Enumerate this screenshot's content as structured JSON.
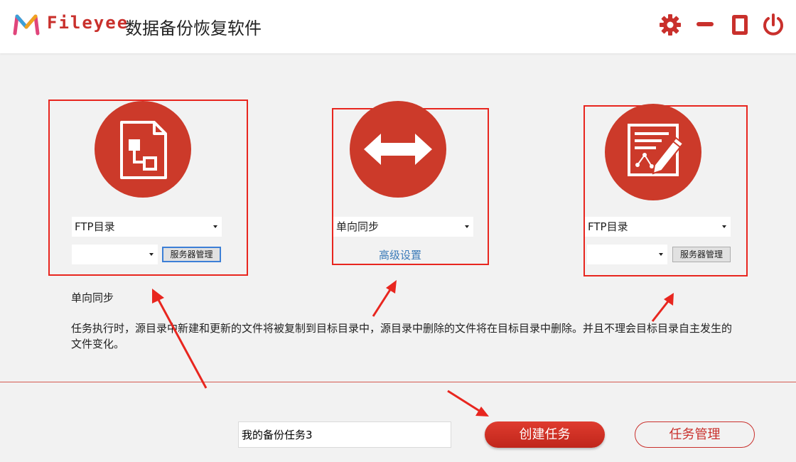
{
  "app": {
    "brand": "Fileyee",
    "title": "数据备份恢复软件"
  },
  "window_controls": [
    {
      "name": "settings",
      "icon": "gear-icon"
    },
    {
      "name": "minimize",
      "icon": "minimize-icon"
    },
    {
      "name": "maximize",
      "icon": "maximize-icon"
    },
    {
      "name": "close",
      "icon": "power-icon"
    }
  ],
  "source": {
    "icon": "file-diagram-icon",
    "type_select": "FTP目录",
    "server_select": "",
    "server_button": "服务器管理"
  },
  "sync": {
    "icon": "double-arrow-icon",
    "mode_select": "单向同步",
    "advanced_link": "高级设置"
  },
  "target": {
    "icon": "edit-document-icon",
    "type_select": "FTP目录",
    "server_select": "",
    "server_button": "服务器管理"
  },
  "description": {
    "title": "单向同步",
    "text": "任务执行时，源目录中新建和更新的文件将被复制到目标目录中，源目录中删除的文件将在目标目录中删除。并且不理会目标目录自主发生的文件变化。"
  },
  "footer": {
    "task_name_value": "我的备份任务3",
    "create_button": "创建任务",
    "manage_button": "任务管理"
  },
  "colors": {
    "accent": "#cc3a2a",
    "highlight_box": "#e8261f",
    "link": "#3a7ab8"
  }
}
